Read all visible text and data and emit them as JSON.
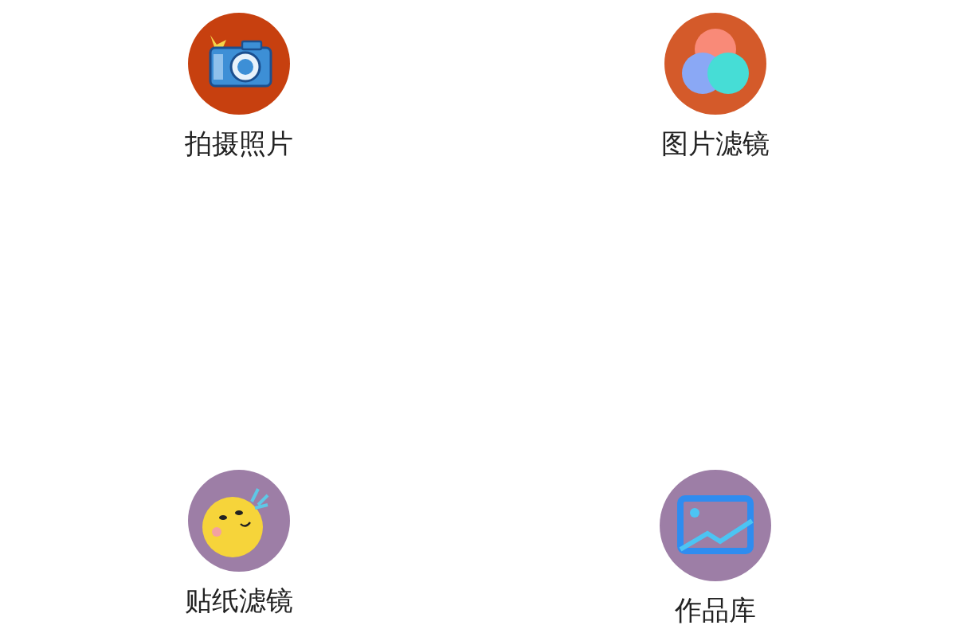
{
  "tiles": [
    {
      "kind": "camera",
      "label": "拍摄照片"
    },
    {
      "kind": "filter",
      "label": "图片滤镜"
    },
    {
      "kind": "sticker",
      "label": "贴纸滤镜"
    },
    {
      "kind": "gallery",
      "label": "作品库"
    }
  ]
}
